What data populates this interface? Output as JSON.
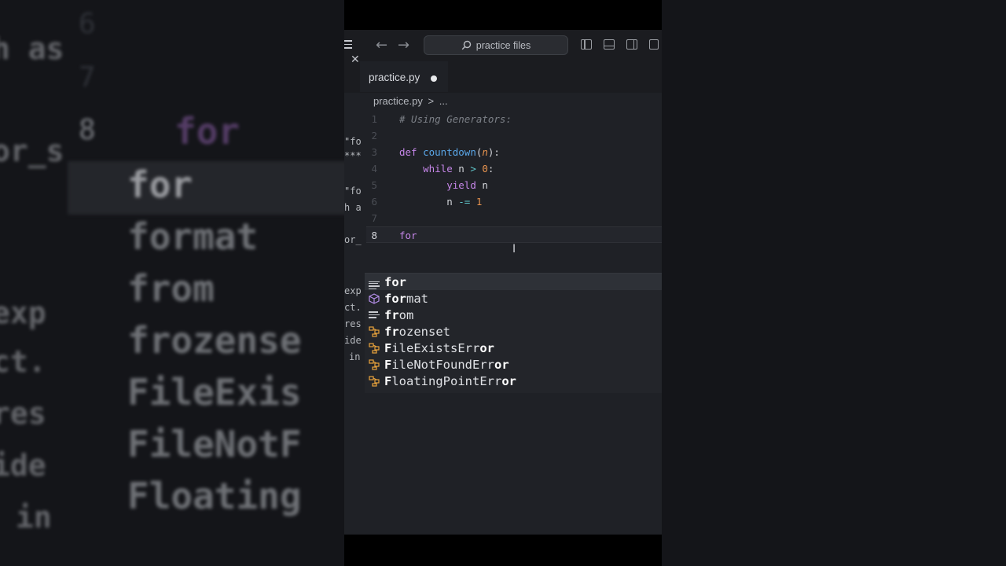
{
  "titlebar": {
    "search_placeholder": "practice files",
    "back_arrow": "←",
    "forward_arrow": "→"
  },
  "tab": {
    "label": "practice.py",
    "close_glyph": "✕"
  },
  "breadcrumb": {
    "file": "practice.py",
    "separator": ">",
    "more": "..."
  },
  "code": {
    "lines": [
      {
        "num": "1",
        "comment": "# Using Generators:"
      },
      {
        "num": "2"
      },
      {
        "num": "3",
        "kw": "def",
        "fn": "countdown",
        "open": "(",
        "param": "n",
        "close": "):"
      },
      {
        "num": "4",
        "indent": "    ",
        "kw": "while",
        "rest": " n ",
        "op": ">",
        "space": " ",
        "val": "0",
        "colon": ":"
      },
      {
        "num": "5",
        "indent": "        ",
        "kw": "yield",
        "rest": " n"
      },
      {
        "num": "6",
        "indent": "        ",
        "rest": "n ",
        "op": "-=",
        "space": " ",
        "val": "1"
      },
      {
        "num": "7"
      },
      {
        "num": "8",
        "kw": "for"
      }
    ],
    "ibeam": "I"
  },
  "suggestions": [
    {
      "match": "for",
      "rest": "",
      "icon": "keyword-icon"
    },
    {
      "match": "for",
      "rest": "mat",
      "icon": "cube-icon"
    },
    {
      "match": "fr",
      "rest": "om",
      "icon": "keyword-icon"
    },
    {
      "match": "fr",
      "rest": "ozenset",
      "icon": "class-icon"
    },
    {
      "match": "F",
      "rest": "ileExistsErr",
      "tail": "or",
      "icon": "class-icon"
    },
    {
      "match": "F",
      "rest": "ileNotFoundErr",
      "tail": "or",
      "icon": "class-icon"
    },
    {
      "match": "F",
      "rest": "loatingPointErr",
      "tail": "or",
      "icon": "class-icon"
    }
  ],
  "strip": {
    "items": [
      "\"fo",
      "***",
      "\"fo",
      "h a",
      "or_",
      "exp",
      "ct.",
      "res",
      "ide",
      "in"
    ]
  },
  "background": {
    "left_numbers": [
      "6",
      "7",
      "8"
    ],
    "left_code": "for",
    "left_words": [
      "for",
      "format",
      "from",
      "frozense",
      "FileExis",
      "FileNotF",
      "Floating"
    ],
    "left_strip": [
      "for",
      "h as",
      "or_s",
      "exp",
      "ct.",
      "res",
      "ide",
      "in"
    ],
    "right_words": []
  },
  "colors": {
    "editor_bg": "#1f2126",
    "keyword": "#c586e8",
    "function": "#5aa7e8",
    "param": "#e8944f",
    "comment": "#7c8087",
    "class_icon": "#e8a33c",
    "cube_icon": "#b48ee8"
  }
}
